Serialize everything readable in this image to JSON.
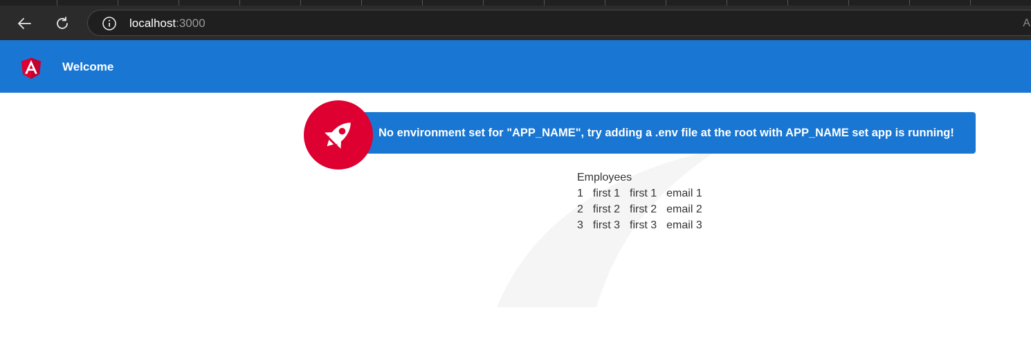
{
  "browser": {
    "address_host": "localhost",
    "address_port": ":3000",
    "reader_glyph": "A"
  },
  "toolbar": {
    "title": "Welcome",
    "color": "#1976d2"
  },
  "banner": {
    "text": "No environment set for \"APP_NAME\", try adding a .env file at the root with APP_NAME set app is running!",
    "icon": "rocket-icon",
    "accent": "#dd0031"
  },
  "employees": {
    "heading": "Employees",
    "rows": [
      {
        "id": "1",
        "first": "first 1",
        "last": "first 1",
        "email": "email 1"
      },
      {
        "id": "2",
        "first": "first 2",
        "last": "first 2",
        "email": "email 2"
      },
      {
        "id": "3",
        "first": "first 3",
        "last": "first 3",
        "email": "email 3"
      }
    ]
  }
}
